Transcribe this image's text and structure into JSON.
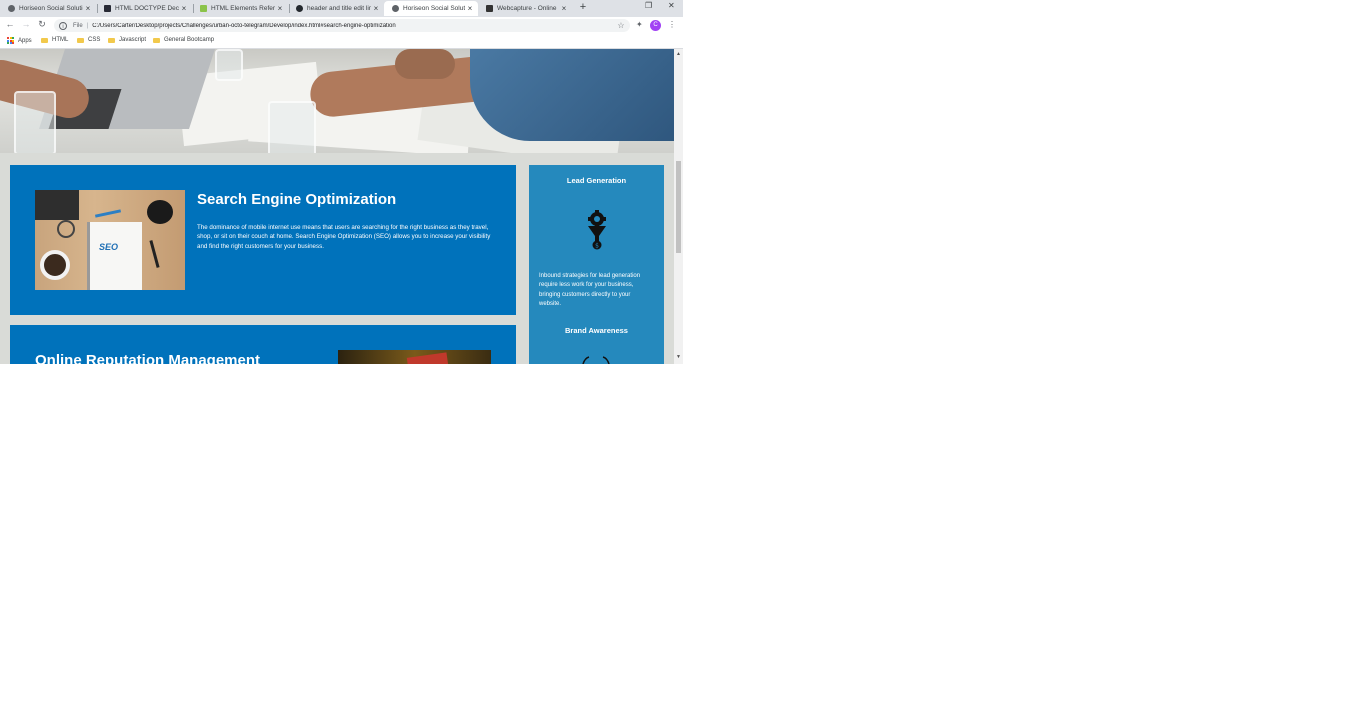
{
  "browser": {
    "tabs": [
      {
        "title": "Horiseon Social Solution",
        "active": false,
        "favicon_color": "#5f6368"
      },
      {
        "title": "HTML DOCTYPE Declaration",
        "active": false,
        "favicon_color": "#282a35"
      },
      {
        "title": "HTML Elements Reference",
        "active": false,
        "favicon_color": "#8bc34a"
      },
      {
        "title": "header and title edit links",
        "active": false,
        "favicon_color": "#24292e"
      },
      {
        "title": "Horiseon Social Solution",
        "active": true,
        "favicon_color": "#5f6368"
      },
      {
        "title": "Webcapture - Online",
        "active": false,
        "favicon_color": "#333333"
      }
    ],
    "new_tab": "+",
    "omnibox": {
      "scheme": "File",
      "url": "C:/Users/Carter/Desktop/projects/Challenges/urban-octo-telegram/Develop/index.html#search-engine-optimization"
    },
    "profile_initial": "C",
    "bookmarks": [
      {
        "label": "Apps",
        "icon": "apps-grid-icon"
      },
      {
        "label": "HTML",
        "icon": "folder-icon"
      },
      {
        "label": "CSS",
        "icon": "folder-icon"
      },
      {
        "label": "Javascript",
        "icon": "folder-icon"
      },
      {
        "label": "General Bootcamp",
        "icon": "folder-icon"
      }
    ]
  },
  "page": {
    "seo": {
      "title": "Search Engine Optimization",
      "text": "The dominance of mobile internet use means that users are searching for the right business as they travel, shop, or sit on their couch at home. Search Engine Optimization (SEO) allows you to increase your visibility and find the right customers for your business.",
      "image_word": "SEO"
    },
    "orm": {
      "title": "Online Reputation Management"
    },
    "aside": {
      "lead": {
        "heading": "Lead Generation",
        "text": "Inbound strategies for lead generation require less work for your business, bringing customers directly to your website."
      },
      "brand": {
        "heading": "Brand Awareness"
      }
    }
  },
  "colors": {
    "card_blue": "#0072bb",
    "aside_blue": "#2589bd",
    "page_bg": "#d9dbd7",
    "text": "#ffffff"
  }
}
